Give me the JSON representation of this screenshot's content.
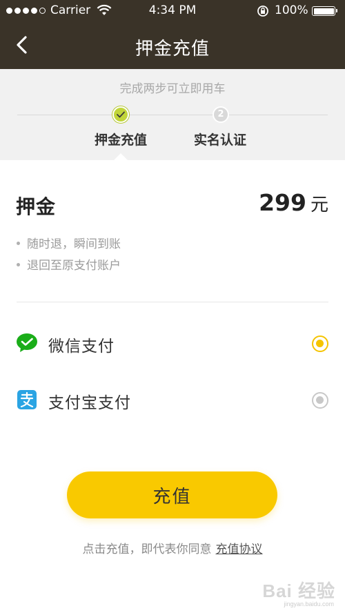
{
  "status_bar": {
    "carrier": "Carrier",
    "time": "4:34 PM",
    "battery": "100%"
  },
  "nav": {
    "title": "押金充值",
    "back_icon": "chevron-left-icon"
  },
  "steps": {
    "hint": "完成两步可立即用车",
    "items": [
      {
        "label": "押金充值",
        "state": "done",
        "marker": ""
      },
      {
        "label": "实名认证",
        "state": "pending",
        "marker": "2"
      }
    ]
  },
  "deposit": {
    "title": "押金",
    "amount": "299",
    "unit": "元",
    "notes": [
      "随时退，瞬间到账",
      "退回至原支付账户"
    ]
  },
  "payment": {
    "options": [
      {
        "label": "微信支付",
        "icon": "wechat-pay-icon",
        "selected": true
      },
      {
        "label": "支付宝支付",
        "icon": "alipay-icon",
        "selected": false
      }
    ]
  },
  "charge": {
    "button_label": "充值",
    "agreement_text": "点击充值，即代表你同意",
    "agreement_link": "充值协议"
  },
  "watermark": {
    "text": "Bai 经验",
    "sub": "jingyan.baidu.com"
  },
  "colors": {
    "header_bg": "#3a3328",
    "accent": "#f9c900",
    "step_done": "#c1d53a",
    "wechat_green": "#1aad19",
    "alipay_blue": "#2aa4e3"
  }
}
